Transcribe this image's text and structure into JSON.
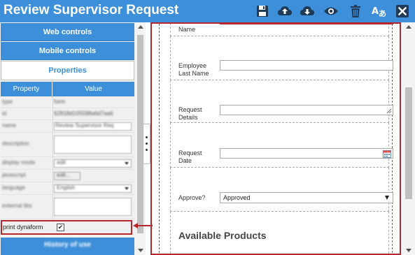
{
  "window": {
    "title": "Review Supervisor Request"
  },
  "toolbar": {
    "icons": [
      "save-icon",
      "upload-icon",
      "download-icon",
      "eye-icon",
      "trash-icon",
      "translate-icon",
      "close-icon"
    ]
  },
  "left_panel": {
    "accordion": [
      {
        "label": "Web controls",
        "active": false
      },
      {
        "label": "Mobile controls",
        "active": false
      },
      {
        "label": "Properties",
        "active": true
      }
    ],
    "table_headers": {
      "property": "Property",
      "value": "Value"
    },
    "rows": [
      {
        "label": "type",
        "value": "form"
      },
      {
        "label": "id",
        "value": "62818d105598a6d7aa6"
      },
      {
        "label": "name",
        "value": "Review Supervisor Req"
      },
      {
        "label": "description",
        "value": ""
      },
      {
        "label": "display mode",
        "value": "edit"
      },
      {
        "label": "javascript",
        "value": "edit..."
      },
      {
        "label": "language",
        "value": "English"
      },
      {
        "label": "external libs",
        "value": ""
      }
    ],
    "print_dynaform": {
      "label": "print dynaform",
      "check": "✔",
      "checked": true
    },
    "history_button": "History of use"
  },
  "form": {
    "fields": [
      {
        "label_line1": "",
        "label_line2": "Name",
        "type": "text"
      },
      {
        "label_line1": "Employee",
        "label_line2": "Last Name",
        "type": "text"
      },
      {
        "label_line1": "Request",
        "label_line2": "Details",
        "type": "textarea"
      },
      {
        "label_line1": "Request",
        "label_line2": "Date",
        "type": "date"
      },
      {
        "label_line1": "Approve?",
        "label_line2": "",
        "type": "dropdown",
        "selected": "Approved"
      }
    ],
    "section_title": "Available Products"
  },
  "colors": {
    "accent": "#3d8fd9",
    "highlight": "#b5262d"
  }
}
